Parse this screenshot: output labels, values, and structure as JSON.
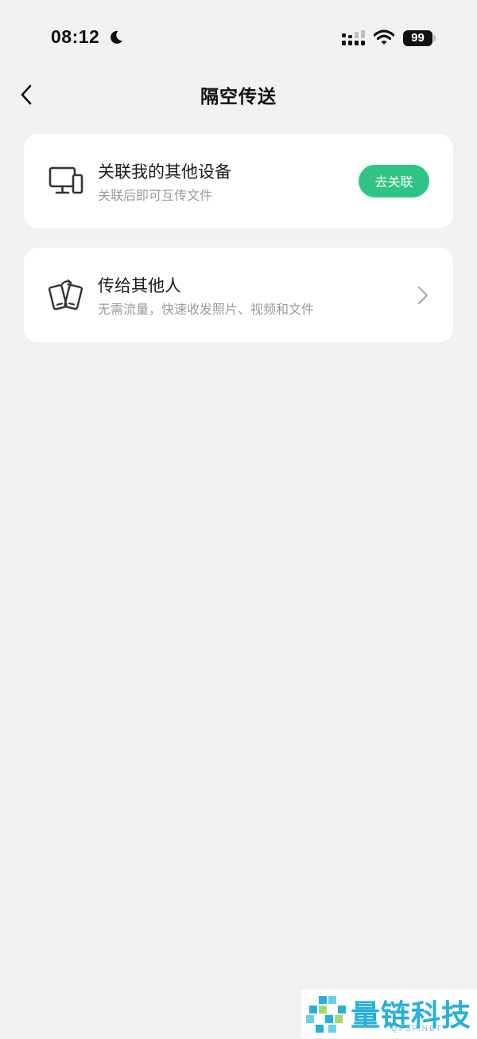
{
  "status_bar": {
    "time": "08:12",
    "battery": "99",
    "icons": [
      "moon-icon",
      "signal-icon",
      "wifi-icon",
      "battery-icon"
    ]
  },
  "nav": {
    "back_icon": "chevron-left-icon",
    "title": "隔空传送"
  },
  "cards": [
    {
      "icon": "devices-icon",
      "title": "关联我的其他设备",
      "subtitle": "关联后即可互传文件",
      "action_label": "去关联"
    },
    {
      "icon": "phones-transfer-icon",
      "title": "传给其他人",
      "subtitle": "无需流量，快速收发照片、视频和文件",
      "action_icon": "chevron-right-icon"
    }
  ],
  "colors": {
    "background": "#f1f1f1",
    "card": "#ffffff",
    "accent": "#2fc486",
    "watermark": "#27b0d8"
  },
  "watermark": {
    "text": "量链科技",
    "sub": "QFSP.NET"
  }
}
